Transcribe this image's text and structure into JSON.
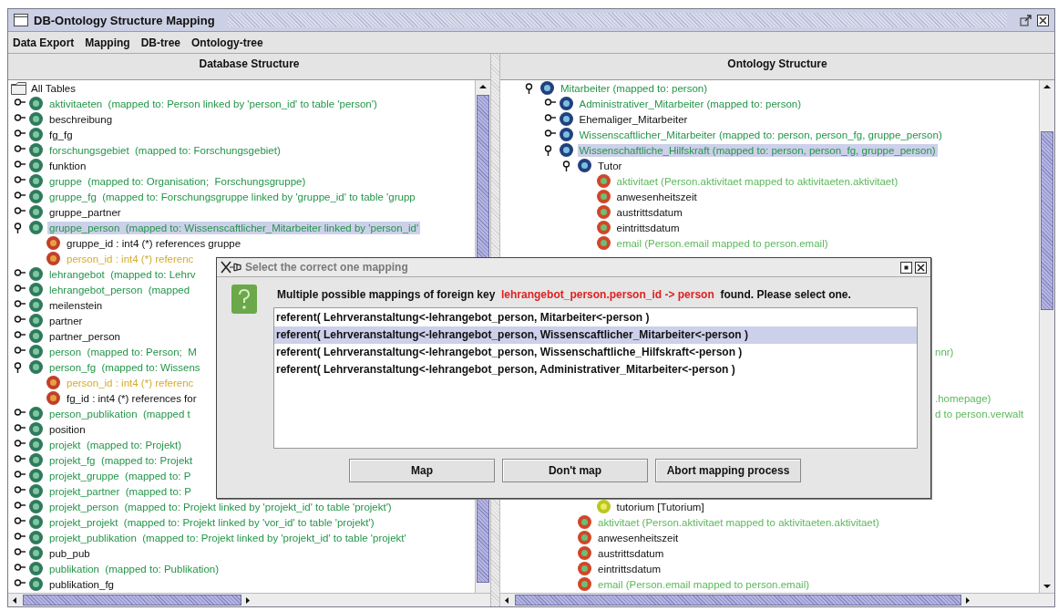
{
  "window": {
    "title": "DB-Ontology Structure Mapping"
  },
  "menu": [
    "Data Export",
    "Mapping",
    "DB-tree",
    "Ontology-tree"
  ],
  "database": {
    "heading": "Database Structure",
    "tree": [
      {
        "kind": "root",
        "label": "All Tables",
        "selected": false,
        "children": [
          {
            "kind": "table",
            "label": "aktivitaeten  (mapped to: Person linked by 'person_id' to table 'person')",
            "mapped": true,
            "expanded": false,
            "selected": false
          },
          {
            "kind": "table",
            "label": "beschreibung",
            "mapped": false,
            "expanded": false,
            "selected": false
          },
          {
            "kind": "table",
            "label": "fg_fg",
            "mapped": false,
            "expanded": false,
            "selected": false
          },
          {
            "kind": "table",
            "label": "forschungsgebiet  (mapped to: Forschungsgebiet)",
            "mapped": true,
            "expanded": false,
            "selected": false
          },
          {
            "kind": "table",
            "label": "funktion",
            "mapped": false,
            "expanded": false,
            "selected": false
          },
          {
            "kind": "table",
            "label": "gruppe  (mapped to: Organisation;  Forschungsgruppe)",
            "mapped": true,
            "expanded": false,
            "selected": false
          },
          {
            "kind": "table",
            "label": "gruppe_fg  (mapped to: Forschungsgruppe linked by 'gruppe_id' to table 'grupp",
            "mapped": true,
            "expanded": false,
            "selected": false
          },
          {
            "kind": "table",
            "label": "gruppe_partner",
            "mapped": false,
            "expanded": false,
            "selected": false
          },
          {
            "kind": "table",
            "label": "gruppe_person  (mapped to: Wissenscaftlicher_Mitarbeiter linked by 'person_id'",
            "mapped": true,
            "expanded": true,
            "selected": true,
            "children": [
              {
                "kind": "field",
                "label": "gruppe_id : int4 (*) references gruppe",
                "mapped": false,
                "selected": false
              },
              {
                "kind": "field",
                "label": "person_id : int4 (*) referenc",
                "mapped": true,
                "selected": false
              }
            ]
          },
          {
            "kind": "table",
            "label": "lehrangebot  (mapped to: Lehrv",
            "mapped": true,
            "expanded": false,
            "selected": false
          },
          {
            "kind": "table",
            "label": "lehrangebot_person  (mapped",
            "mapped": true,
            "expanded": false,
            "selected": false
          },
          {
            "kind": "table",
            "label": "meilenstein",
            "mapped": false,
            "expanded": false,
            "selected": false
          },
          {
            "kind": "table",
            "label": "partner",
            "mapped": false,
            "expanded": false,
            "selected": false
          },
          {
            "kind": "table",
            "label": "partner_person",
            "mapped": false,
            "expanded": false,
            "selected": false
          },
          {
            "kind": "table",
            "label": "person  (mapped to: Person;  M",
            "mapped": true,
            "expanded": false,
            "selected": false
          },
          {
            "kind": "table",
            "label": "person_fg  (mapped to: Wissens",
            "mapped": true,
            "expanded": true,
            "selected": false,
            "children": [
              {
                "kind": "field",
                "label": "person_id : int4 (*) referenc",
                "mapped": true,
                "selected": false
              },
              {
                "kind": "field",
                "label": "fg_id : int4 (*) references for",
                "mapped": false,
                "selected": false
              }
            ]
          },
          {
            "kind": "table",
            "label": "person_publikation  (mapped t",
            "mapped": true,
            "expanded": false,
            "selected": false
          },
          {
            "kind": "table",
            "label": "position",
            "mapped": false,
            "expanded": false,
            "selected": false
          },
          {
            "kind": "table",
            "label": "projekt  (mapped to: Projekt)",
            "mapped": true,
            "expanded": false,
            "selected": false
          },
          {
            "kind": "table",
            "label": "projekt_fg  (mapped to: Projekt",
            "mapped": true,
            "expanded": false,
            "selected": false
          },
          {
            "kind": "table",
            "label": "projekt_gruppe  (mapped to: P",
            "mapped": true,
            "expanded": false,
            "selected": false
          },
          {
            "kind": "table",
            "label": "projekt_partner  (mapped to: P",
            "mapped": true,
            "expanded": false,
            "selected": false
          },
          {
            "kind": "table",
            "label": "projekt_person  (mapped to: Projekt linked by 'projekt_id' to table 'projekt')",
            "mapped": true,
            "expanded": false,
            "selected": false
          },
          {
            "kind": "table",
            "label": "projekt_projekt  (mapped to: Projekt linked by 'vor_id' to table 'projekt')",
            "mapped": true,
            "expanded": false,
            "selected": false
          },
          {
            "kind": "table",
            "label": "projekt_publikation  (mapped to: Projekt linked by 'projekt_id' to table 'projekt'",
            "mapped": true,
            "expanded": false,
            "selected": false
          },
          {
            "kind": "table",
            "label": "pub_pub",
            "mapped": false,
            "expanded": false,
            "selected": false
          },
          {
            "kind": "table",
            "label": "publikation  (mapped to: Publikation)",
            "mapped": true,
            "expanded": false,
            "selected": false
          },
          {
            "kind": "table",
            "label": "publikation_fg",
            "mapped": false,
            "expanded": false,
            "selected": false
          }
        ]
      }
    ]
  },
  "ontology": {
    "heading": "Ontology Structure",
    "tree": [
      {
        "kind": "class",
        "label": "Mitarbeiter (mapped to: person)",
        "mapped": true,
        "expanded": true,
        "selected": false,
        "children": [
          {
            "kind": "class",
            "label": "Administrativer_Mitarbeiter (mapped to: person)",
            "mapped": true,
            "expanded": false,
            "selected": false
          },
          {
            "kind": "class",
            "label": "Ehemaliger_Mitarbeiter",
            "mapped": false,
            "expanded": false,
            "selected": false
          },
          {
            "kind": "class",
            "label": "Wissenscaftlicher_Mitarbeiter (mapped to: person, person_fg, gruppe_person)",
            "mapped": true,
            "expanded": false,
            "selected": false
          },
          {
            "kind": "class",
            "label": "Wissenschaftliche_Hilfskraft (mapped to: person, person_fg, gruppe_person)",
            "mapped": true,
            "expanded": true,
            "selected": true,
            "children": [
              {
                "kind": "class",
                "label": "Tutor",
                "mapped": false,
                "expanded": true,
                "selected": false,
                "children": [
                  {
                    "kind": "attribute",
                    "label": "aktivitaet (Person.aktivitaet mapped to aktivitaeten.aktivitaet)",
                    "mapped": true,
                    "selected": false
                  },
                  {
                    "kind": "attribute",
                    "label": "anwesenheitszeit",
                    "mapped": false,
                    "selected": false
                  },
                  {
                    "kind": "attribute",
                    "label": "austrittsdatum",
                    "mapped": false,
                    "selected": false
                  },
                  {
                    "kind": "attribute",
                    "label": "eintrittsdatum",
                    "mapped": false,
                    "selected": false
                  },
                  {
                    "kind": "attribute",
                    "label": "email (Person.email mapped to person.email)",
                    "mapped": true,
                    "selected": false
                  },
                  {
                    "kind": "fragment",
                    "label": "nnr)",
                    "mapped": true,
                    "selected": false
                  },
                  {
                    "kind": "fragment",
                    "label": ".homepage)",
                    "mapped": true,
                    "selected": false
                  },
                  {
                    "kind": "fragment",
                    "label": "d to person.verwalt",
                    "mapped": true,
                    "selected": false
                  },
                  {
                    "kind": "relation",
                    "label": "tutorium [Tutorium]",
                    "selected": false
                  }
                ]
              },
              {
                "kind": "attribute",
                "label": "aktivitaet (Person.aktivitaet mapped to aktivitaeten.aktivitaet)",
                "mapped": true,
                "selected": false
              },
              {
                "kind": "attribute",
                "label": "anwesenheitszeit",
                "mapped": false,
                "selected": false
              },
              {
                "kind": "attribute",
                "label": "austrittsdatum",
                "mapped": false,
                "selected": false
              },
              {
                "kind": "attribute",
                "label": "eintrittsdatum",
                "mapped": false,
                "selected": false
              },
              {
                "kind": "attribute",
                "label": "email (Person.email mapped to person.email)",
                "mapped": true,
                "selected": false
              }
            ]
          }
        ]
      }
    ]
  },
  "dialog": {
    "title": "Select the correct one mapping",
    "message": {
      "before": "Multiple possible mappings of foreign key  ",
      "key": "lehrangebot_person.person_id -> person",
      "after": "  found. Please select one."
    },
    "options": [
      {
        "label": "referent( Lehrveranstaltung<-lehrangebot_person, Mitarbeiter<-person )",
        "selected": false
      },
      {
        "label": "referent( Lehrveranstaltung<-lehrangebot_person, Wissenscaftlicher_Mitarbeiter<-person )",
        "selected": true
      },
      {
        "label": "referent( Lehrveranstaltung<-lehrangebot_person, Wissenschaftliche_Hilfskraft<-person )",
        "selected": false
      },
      {
        "label": "referent( Lehrveranstaltung<-lehrangebot_person, Administrativer_Mitarbeiter<-person )",
        "selected": false
      }
    ],
    "buttons": [
      "Map",
      "Don't map",
      "Abort mapping process"
    ]
  }
}
